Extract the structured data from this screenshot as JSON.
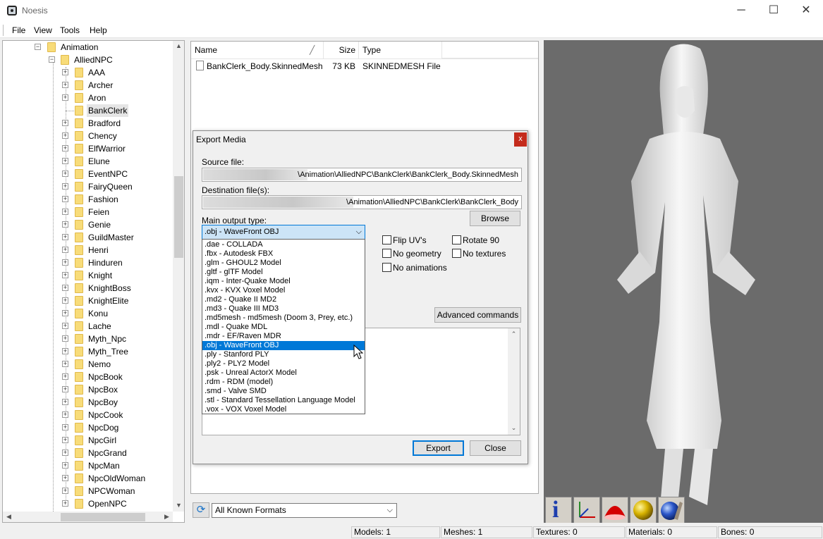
{
  "window": {
    "title": "Noesis",
    "minimize_glyph": "─",
    "maximize_glyph": "☐",
    "close_glyph": "✕"
  },
  "menu": [
    "File",
    "View",
    "Tools",
    "Help"
  ],
  "tree": {
    "root_label": "Animation",
    "parent_label": "AlliedNPC",
    "items": [
      "AAA",
      "Archer",
      "Aron",
      "BankClerk",
      "Bradford",
      "Chency",
      "ElfWarrior",
      "Elune",
      "EventNPC",
      "FairyQueen",
      "Fashion",
      "Feien",
      "Genie",
      "GuildMaster",
      "Henri",
      "Hinduren",
      "Knight",
      "KnightBoss",
      "KnightElite",
      "Konu",
      "Lache",
      "Myth_Npc",
      "Myth_Tree",
      "Nemo",
      "NpcBook",
      "NpcBox",
      "NpcBoy",
      "NpcCook",
      "NpcDog",
      "NpcGirl",
      "NpcGrand",
      "NpcMan",
      "NpcOldWoman",
      "NPCWoman",
      "OpenNPC"
    ],
    "selected": "BankClerk"
  },
  "file_list": {
    "columns": {
      "name": "Name",
      "size": "Size",
      "type": "Type"
    },
    "rows": [
      {
        "name": "BankClerk_Body.SkinnedMesh",
        "size": "73 KB",
        "type": "SKINNEDMESH File"
      }
    ]
  },
  "filter": {
    "value": "All Known Formats"
  },
  "status": {
    "models": "Models: 1",
    "meshes": "Meshes: 1",
    "textures": "Textures: 0",
    "materials": "Materials: 0",
    "bones": "Bones: 0"
  },
  "dialog": {
    "title": "Export Media",
    "close_glyph": "x",
    "source_label": "Source file:",
    "source_value": "\\Animation\\AlliedNPC\\BankClerk\\BankClerk_Body.SkinnedMesh",
    "dest_label": "Destination file(s):",
    "dest_value": "\\Animation\\AlliedNPC\\BankClerk\\BankClerk_Body",
    "browse": "Browse",
    "output_label": "Main output type:",
    "output_value": ".obj - WaveFront OBJ",
    "options": {
      "flip_uvs": "Flip UV's",
      "rotate_90": "Rotate 90",
      "no_geometry": "No geometry",
      "no_textures": "No textures",
      "no_animations": "No animations"
    },
    "advanced": "Advanced commands",
    "export": "Export",
    "close": "Close"
  },
  "output_formats": [
    ".dae - COLLADA",
    ".fbx - Autodesk FBX",
    ".glm - GHOUL2 Model",
    ".gltf - glTF Model",
    ".iqm - Inter-Quake Model",
    ".kvx - KVX Voxel Model",
    ".md2 - Quake II MD2",
    ".md3 - Quake III MD3",
    ".md5mesh - md5mesh (Doom 3, Prey, etc.)",
    ".mdl - Quake MDL",
    ".mdr - EF/Raven MDR",
    ".obj - WaveFront OBJ",
    ".ply - Stanford PLY",
    ".ply2 - PLY2 Model",
    ".psk - Unreal ActorX Model",
    ".rdm - RDM (model)",
    ".smd - Valve SMD",
    ".stl - Standard Tessellation Language Model",
    ".vox - VOX Voxel Model"
  ],
  "selected_format": ".obj - WaveFront OBJ",
  "viewport_tools": [
    "info-icon",
    "axes-icon",
    "red-dome-icon",
    "yellow-sphere-icon",
    "blue-sphere-icon"
  ],
  "colors": {
    "accent": "#0078d7",
    "viewport_bg": "#6b6b6b",
    "close_red": "#c42b1c"
  }
}
